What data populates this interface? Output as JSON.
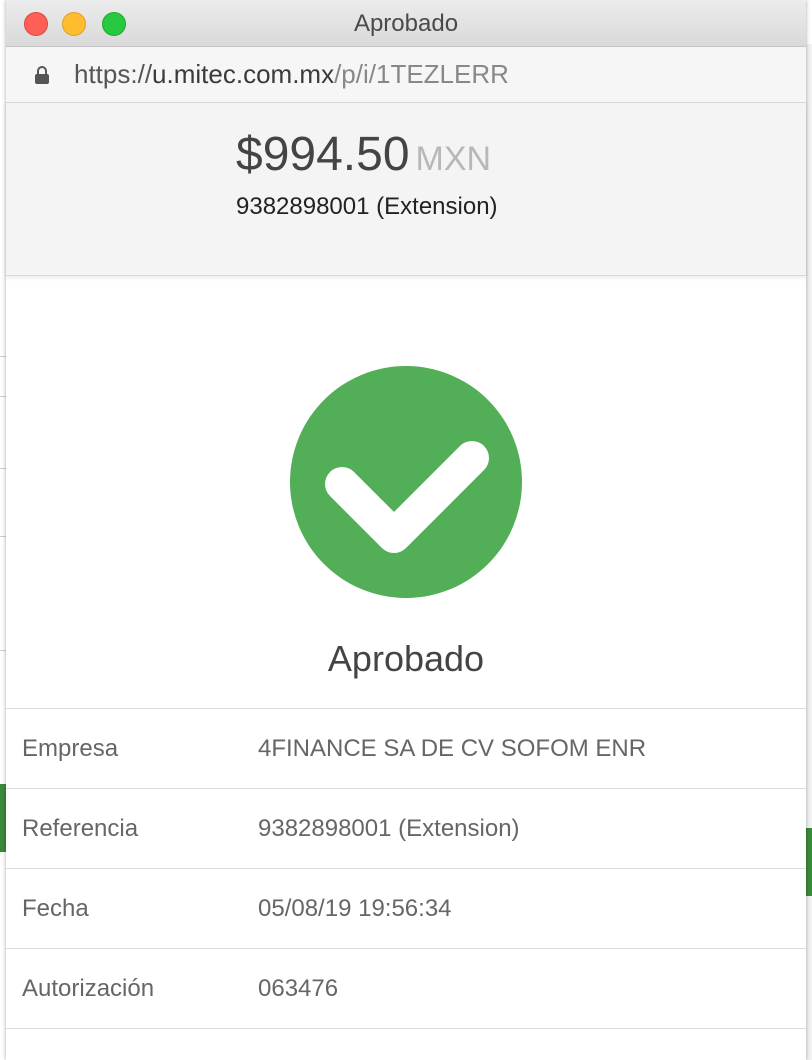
{
  "window": {
    "title": "Aprobado"
  },
  "address_bar": {
    "scheme": "https://",
    "host": "u.mitec.com.mx",
    "path": "/p/i/1TEZLERR"
  },
  "payment": {
    "amount": "$994.50",
    "currency": "MXN",
    "reference_line": "9382898001 (Extension)"
  },
  "status": {
    "label": "Aprobado",
    "color": "#52ae57"
  },
  "details": [
    {
      "label": "Empresa",
      "value": "4FINANCE SA DE CV SOFOM ENR"
    },
    {
      "label": "Referencia",
      "value": "9382898001 (Extension)"
    },
    {
      "label": "Fecha",
      "value": "05/08/19 19:56:34"
    },
    {
      "label": "Autorización",
      "value": "063476"
    }
  ],
  "icons": {
    "lock": "lock-icon",
    "check": "check-icon"
  }
}
